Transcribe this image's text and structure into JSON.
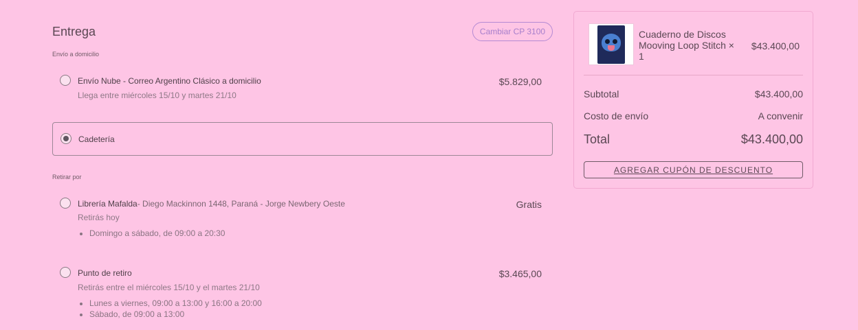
{
  "delivery": {
    "title": "Entrega",
    "change_cp_label": "Cambiar CP 3100",
    "home_section_label": "Envío a domicilio",
    "pickup_section_label": "Retirar por",
    "options": [
      {
        "name": "Envío Nube - Correo Argentino Clásico a domicilio",
        "detail": "Llega entre miércoles 15/10 y martes 21/10",
        "price": "$5.829,00",
        "selected": false
      },
      {
        "name": "Cadetería",
        "selected": true
      }
    ],
    "pickup_options": [
      {
        "name": "Librería Mafalda",
        "address": "- Diego Mackinnon 1448, Paraná - Jorge Newbery Oeste",
        "detail": "Retirás hoy",
        "schedule": [
          "Domingo a sábado, de 09:00 a 20:30"
        ],
        "price": "Gratis",
        "selected": false
      },
      {
        "name": "Punto de retiro",
        "detail": "Retirás entre el miércoles 15/10 y el martes 21/10",
        "schedule": [
          "Lunes a viernes, 09:00 a 13:00 y 16:00 a 20:00",
          "Sábado, de 09:00 a 13:00"
        ],
        "price": "$3.465,00",
        "selected": false
      }
    ]
  },
  "summary": {
    "product": {
      "name": "Cuaderno de Discos Mooving Loop Stitch × 1",
      "price": "$43.400,00",
      "image_icon": "stitch-notebook-thumbnail"
    },
    "subtotal_label": "Subtotal",
    "subtotal_value": "$43.400,00",
    "shipping_label": "Costo de envío",
    "shipping_value": "A convenir",
    "total_label": "Total",
    "total_value": "$43.400,00",
    "coupon_label": "AGREGAR CUPÓN DE DESCUENTO"
  },
  "colors": {
    "background": "#fec5e5",
    "accent": "#a77fcc",
    "text": "#5a4753"
  }
}
